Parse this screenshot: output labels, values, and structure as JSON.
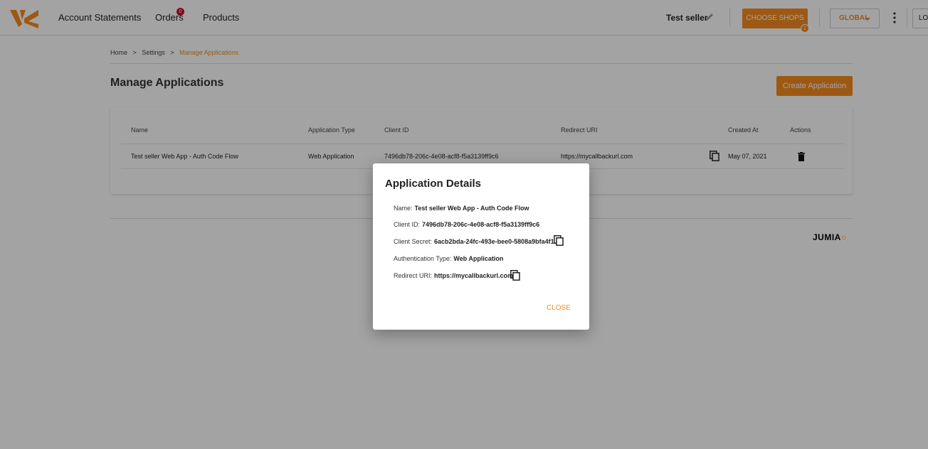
{
  "topbar": {
    "nav": {
      "account_statements": "Account Statements",
      "orders": "Orders",
      "products": "Products"
    },
    "orders_badge": "0",
    "seller_name": "Test seller",
    "choose_shops": "CHOOSE SHOPS",
    "choose_shops_badge": "1",
    "global": "GLOBAL",
    "login": "LO"
  },
  "breadcrumb": {
    "home": "Home",
    "settings": "Settings",
    "current": "Manage Applications",
    "separator": ">"
  },
  "page": {
    "title": "Manage Applications",
    "create_button": "Create Application"
  },
  "table": {
    "headers": {
      "name": "Name",
      "application_type": "Application Type",
      "client_id": "Client ID",
      "redirect_uri": "Redirect URI",
      "created_at": "Created At",
      "actions": "Actions"
    },
    "rows": [
      {
        "name": "Test seller Web App - Auth Code Flow",
        "application_type": "Web Application",
        "client_id": "7496db78-206c-4e08-acf8-f5a3139ff9c6",
        "redirect_uri": "https://mycallbackurl.com",
        "created_at": "May 07, 2021"
      }
    ]
  },
  "footer": {
    "brand": "JUMIA"
  },
  "modal": {
    "title": "Application Details",
    "name_label": "Name:",
    "name_value": "Test seller Web App - Auth Code Flow",
    "client_id_label": "Client ID:",
    "client_id_value": "7496db78-206c-4e08-acf8-f5a3139ff9c6",
    "client_secret_label": "Client Secret:",
    "client_secret_value": "6acb2bda-24fc-493e-bee0-5808a9bfa4f1",
    "auth_type_label": "Authentication Type:",
    "auth_type_value": "Web Application",
    "redirect_label": "Redirect URI:",
    "redirect_value": "https://mycallbackurl.com",
    "close": "CLOSE"
  },
  "colors": {
    "accent": "#f68b1e",
    "badge_red": "#c8102e",
    "overlay": "rgba(0,0,0,0.36)"
  },
  "icons": [
    "logo-icon",
    "pencil-icon",
    "kebab-icon",
    "copy-icon",
    "trash-icon",
    "caret-down-icon"
  ]
}
